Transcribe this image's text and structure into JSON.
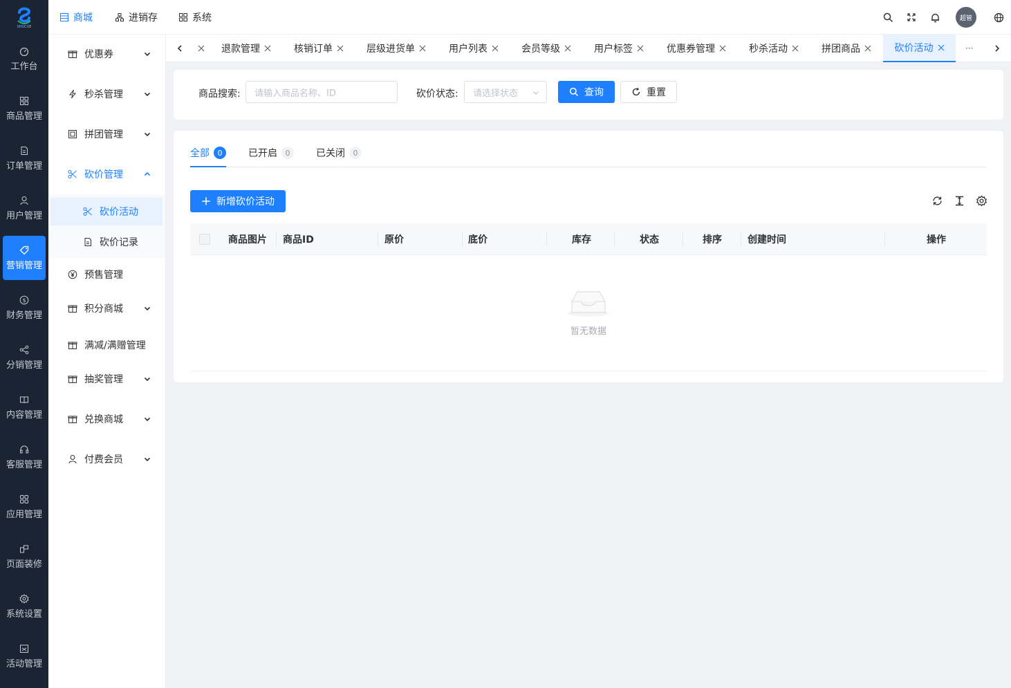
{
  "brand": {
    "logo_text": "SHUCUE"
  },
  "rail": {
    "items": [
      {
        "label": "工作台",
        "icon": "dashboard-icon"
      },
      {
        "label": "商品管理",
        "icon": "grid-icon"
      },
      {
        "label": "订单管理",
        "icon": "document-icon"
      },
      {
        "label": "用户管理",
        "icon": "user-icon"
      },
      {
        "label": "营销管理",
        "icon": "tag-icon"
      },
      {
        "label": "财务管理",
        "icon": "dollar-icon"
      },
      {
        "label": "分销管理",
        "icon": "share-icon"
      },
      {
        "label": "内容管理",
        "icon": "book-icon"
      },
      {
        "label": "客服管理",
        "icon": "headset-icon"
      },
      {
        "label": "应用管理",
        "icon": "apps-icon"
      },
      {
        "label": "页面装修",
        "icon": "layout-icon"
      },
      {
        "label": "系统设置",
        "icon": "gear-icon"
      },
      {
        "label": "活动管理",
        "icon": "calendar-icon"
      }
    ]
  },
  "topbar": {
    "nav": [
      "商城",
      "进销存",
      "系统"
    ],
    "avatar_text": "超管"
  },
  "sidemenu": {
    "items": [
      "优惠券",
      "秒杀管理",
      "拼团管理",
      "砍价管理",
      "预售管理",
      "积分商城",
      "满减/满赠管理",
      "抽奖管理",
      "兑换商城",
      "付费会员"
    ],
    "sub": [
      "砍价活动",
      "砍价记录"
    ]
  },
  "tabs": {
    "items": [
      "退款管理",
      "核销订单",
      "层级进货单",
      "用户列表",
      "会员等级",
      "用户标签",
      "优惠券管理",
      "秒杀活动",
      "拼团商品",
      "砍价活动"
    ],
    "more": "···"
  },
  "filter": {
    "search_label": "商品搜索:",
    "search_placeholder": "请输入商品名称、ID",
    "status_label": "砍价状态:",
    "status_placeholder": "请选择状态",
    "query_button": "查询",
    "reset_button": "重置"
  },
  "status_tabs": [
    {
      "label": "全部",
      "count": "0"
    },
    {
      "label": "已开启",
      "count": "0"
    },
    {
      "label": "已关闭",
      "count": "0"
    }
  ],
  "add_button": "新增砍价活动",
  "table": {
    "columns": [
      "商品图片",
      "商品ID",
      "原价",
      "底价",
      "库存",
      "状态",
      "排序",
      "创建时间",
      "操作"
    ],
    "empty_text": "暂无数据"
  },
  "colors": {
    "accent": "#1e7fff",
    "rail_bg": "#1b2433"
  }
}
